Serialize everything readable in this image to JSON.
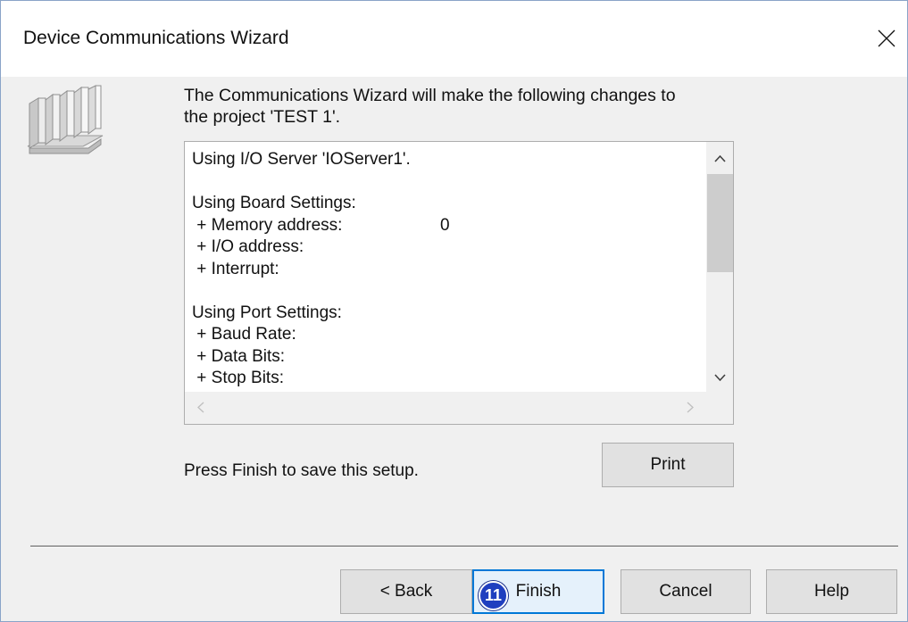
{
  "window": {
    "title": "Device Communications Wizard",
    "close_glyph": "✕"
  },
  "icons": {
    "device": "plc-rack-icon",
    "close": "close-icon",
    "scroll_up": "chevron-up-icon",
    "scroll_down": "chevron-down-icon",
    "scroll_left": "chevron-left-icon",
    "scroll_right": "chevron-right-icon"
  },
  "intro": {
    "line1": "The Communications Wizard will make the following changes to",
    "line2": "the project 'TEST 1'."
  },
  "summary": {
    "lines": [
      {
        "text": "Using I/O Server 'IOServer1'.",
        "value": ""
      },
      {
        "text": "",
        "value": ""
      },
      {
        "text": "Using Board Settings:",
        "value": ""
      },
      {
        "text": " + Memory address:",
        "value": "0"
      },
      {
        "text": " + I/O address:",
        "value": ""
      },
      {
        "text": " + Interrupt:",
        "value": ""
      },
      {
        "text": "",
        "value": ""
      },
      {
        "text": "Using Port Settings:",
        "value": ""
      },
      {
        "text": " + Baud Rate:",
        "value": ""
      },
      {
        "text": " + Data Bits:",
        "value": ""
      },
      {
        "text": " + Stop Bits:",
        "value": ""
      }
    ]
  },
  "hint_text": "Press Finish to save this setup.",
  "buttons": {
    "print": "Print",
    "back": "< Back",
    "finish": "Finish",
    "cancel": "Cancel",
    "help": "Help"
  },
  "step_badge": "11",
  "colors": {
    "dialog_bg": "#f0f0f0",
    "accent": "#0078d7",
    "badge": "#1f3fbf"
  }
}
